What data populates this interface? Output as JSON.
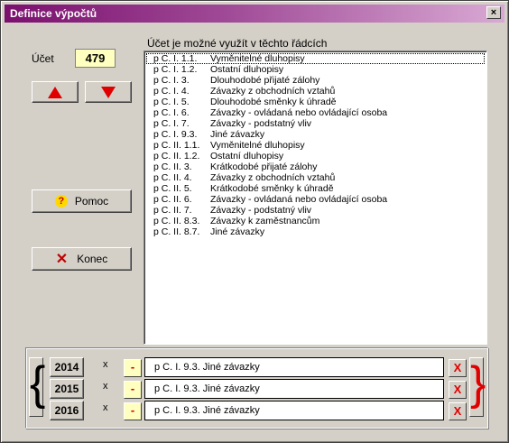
{
  "window": {
    "title": "Definice výpočtů",
    "close_glyph": "×"
  },
  "account": {
    "label": "Účet",
    "value": "479"
  },
  "list": {
    "heading": "Účet je možné využít v těchto řádcích",
    "rows": [
      {
        "code": "p C. I. 1.1.",
        "name": "Vyměnitelné dluhopisy"
      },
      {
        "code": "p C. I. 1.2.",
        "name": "Ostatní dluhopisy"
      },
      {
        "code": "p C. I. 3.",
        "name": "Dlouhodobé přijaté zálohy"
      },
      {
        "code": "p C. I. 4.",
        "name": "Závazky z obchodních vztahů"
      },
      {
        "code": "p C. I. 5.",
        "name": "Dlouhodobé směnky k úhradě"
      },
      {
        "code": "p C. I. 6.",
        "name": "Závazky - ovládaná nebo ovládající osoba"
      },
      {
        "code": "p C. I. 7.",
        "name": "Závazky - podstatný vliv"
      },
      {
        "code": "p C. I. 9.3.",
        "name": "Jiné závazky"
      },
      {
        "code": "p C. II. 1.1.",
        "name": "Vyměnitelné dluhopisy"
      },
      {
        "code": "p C. II. 1.2.",
        "name": "Ostatní dluhopisy"
      },
      {
        "code": "p C. II. 3.",
        "name": "Krátkodobé přijaté zálohy"
      },
      {
        "code": "p C. II. 4.",
        "name": "Závazky z obchodních vztahů"
      },
      {
        "code": "p C. II. 5.",
        "name": "Krátkodobé směnky k úhradě"
      },
      {
        "code": "p C. II. 6.",
        "name": "Závazky - ovládaná nebo ovládající osoba"
      },
      {
        "code": "p C. II. 7.",
        "name": "Závazky - podstatný vliv"
      },
      {
        "code": "p C. II. 8.3.",
        "name": "Závazky k zaměstnancům"
      },
      {
        "code": "p C. II. 8.7.",
        "name": "Jiné závazky"
      }
    ]
  },
  "buttons": {
    "help": "Pomoc",
    "end": "Konec",
    "help_icon": "?",
    "end_icon": "✕"
  },
  "formulas": [
    {
      "year": "2014",
      "x": "x",
      "minus": "-",
      "text": "p C. I. 9.3. Jiné závazky",
      "delete": "X"
    },
    {
      "year": "2015",
      "x": "x",
      "minus": "-",
      "text": "p C. I. 9.3. Jiné závazky",
      "delete": "X"
    },
    {
      "year": "2016",
      "x": "x",
      "minus": "-",
      "text": "p C. I. 9.3. Jiné závazky",
      "delete": "X"
    }
  ],
  "icons": {
    "up": "arrow-up-icon",
    "down": "arrow-down-icon"
  },
  "colors": {
    "title_start": "#7b0f6e",
    "accent_red": "#e00000",
    "value_bg": "#ffffc0"
  }
}
